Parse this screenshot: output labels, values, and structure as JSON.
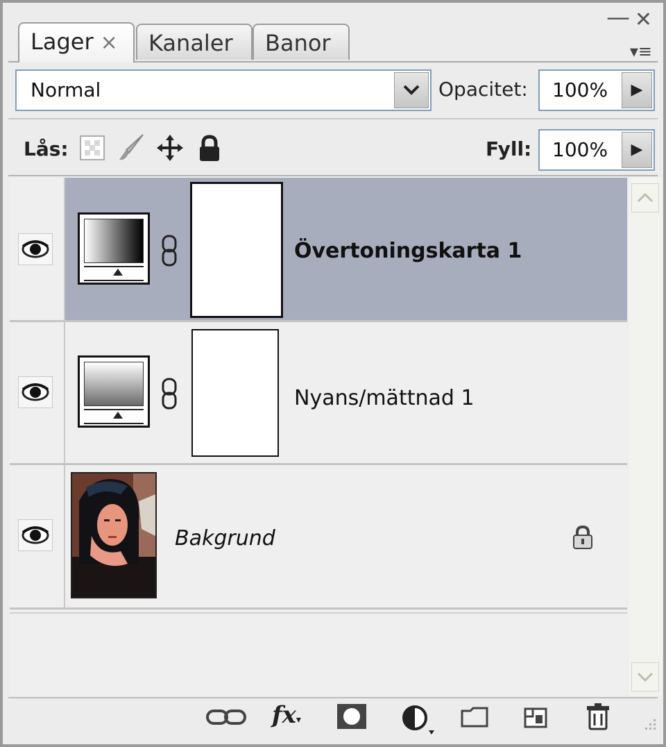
{
  "tabs": [
    {
      "label": "Lager",
      "active": true,
      "close_glyph": "×"
    },
    {
      "label": "Kanaler",
      "active": false
    },
    {
      "label": "Banor",
      "active": false
    }
  ],
  "window_controls": {
    "minimize": "—",
    "close": "✕",
    "flyout": "▾≡"
  },
  "blend_mode": {
    "value": "Normal"
  },
  "opacity": {
    "label": "Opacitet:",
    "value": "100%"
  },
  "lock": {
    "label": "Lås:",
    "icons": [
      "lock-transparency-icon",
      "lock-paint-icon",
      "lock-position-icon",
      "lock-all-icon"
    ]
  },
  "fill": {
    "label": "Fyll:",
    "value": "100%"
  },
  "layers": [
    {
      "name": "Övertoningskarta 1",
      "type": "gradient-map-adjustment",
      "selected": true,
      "visible": true,
      "bold": true
    },
    {
      "name": "Nyans/mättnad 1",
      "type": "hue-saturation-adjustment",
      "selected": false,
      "visible": true,
      "bold": false
    },
    {
      "name": "Bakgrund",
      "type": "image",
      "selected": false,
      "visible": true,
      "italic": true,
      "locked": true
    }
  ],
  "bottom_toolbar": [
    "link-layers-icon",
    "fx-icon",
    "layer-mask-icon",
    "adjustment-layer-icon",
    "group-folder-icon",
    "new-layer-icon",
    "trash-icon"
  ],
  "fx_label": "fx",
  "colors": {
    "selected_row": "#a8adbd",
    "panel_bg": "#ececec",
    "field_border": "#7f9db9"
  }
}
